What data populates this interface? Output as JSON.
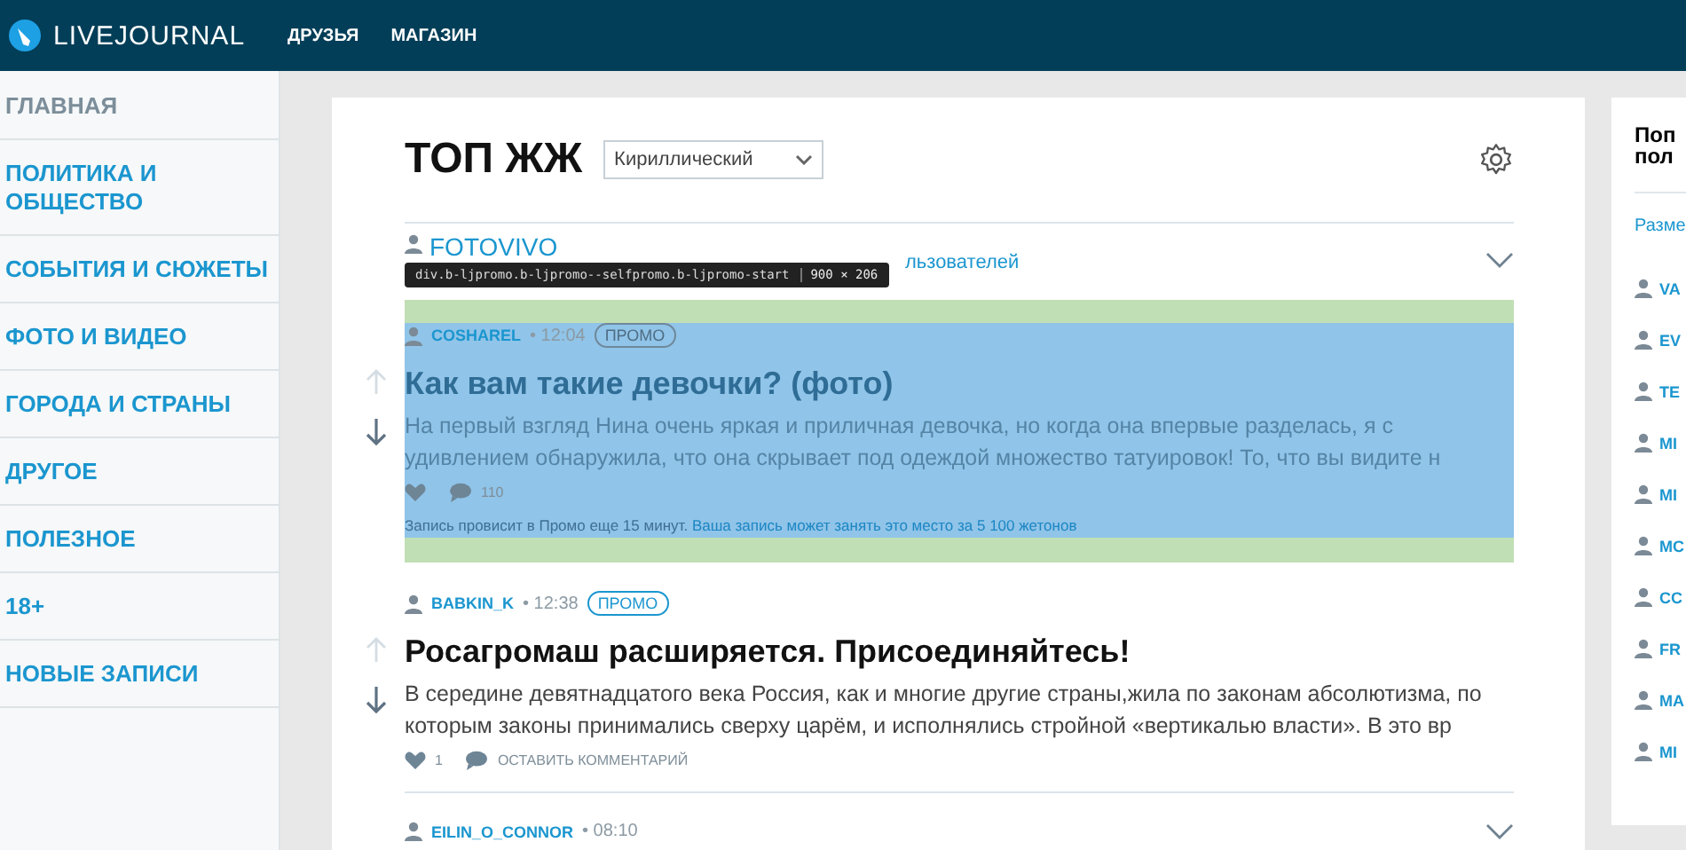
{
  "header": {
    "logo": "LIVEJOURNAL",
    "nav": [
      "ДРУЗЬЯ",
      "МАГАЗИН"
    ]
  },
  "sidebar": {
    "items": [
      "ГЛАВНАЯ",
      "ПОЛИТИКА И ОБЩЕСТВО",
      "СОБЫТИЯ И СЮЖЕТЫ",
      "ФОТО И ВИДЕО",
      "ГОРОДА И СТРАНЫ",
      "ДРУГОЕ",
      "ПОЛЕЗНОЕ",
      "18+",
      "НОВЫЕ ЗАПИСИ"
    ]
  },
  "main": {
    "title": "ТОП ЖЖ",
    "select": {
      "value": "Кириллический"
    },
    "group_row": {
      "author": "FOTOVIVO",
      "text": "льзователей",
      "expanded": false
    },
    "devtools_tooltip": {
      "selector": "div.b-ljpromo.b-ljpromo--selfpromo.b-ljpromo-start",
      "size": "900 × 206"
    },
    "posts": [
      {
        "kind": "promo",
        "highlighted": true,
        "author": "COSHAREL",
        "time": "• 12:04",
        "badge": "ПРОМО",
        "title": "Как вам такие девочки? (фото)",
        "excerpt": "На первый взгляд Нина очень яркая и приличная девочка, но когда она впервые разделась, я с удивлением обнаружила, что она скрывает под одеждой множество татуировок! То, что вы видите н",
        "comments": "110",
        "promo_note": "Запись провисит в Промо еще 15 минут.",
        "promo_link": "Ваша запись может занять это место за 5 100 жетонов"
      },
      {
        "kind": "post",
        "highlighted": false,
        "author": "BABKIN_K",
        "time": "• 12:38",
        "badge": "ПРОМО",
        "title": "Росагромаш расширяется. Присоединяйтесь!",
        "excerpt": "В середине девятнадцатого века Россия, как и многие другие страны,жила по законам абсолютизма, по которым законы принимались сверху царём, и исполнялись стройной «вертикалью власти». В это вр",
        "likes": "1",
        "comments": "ОСТАВИТЬ КОММЕНТАРИЙ"
      },
      {
        "kind": "collapsed",
        "author": "EILIN_O_CONNOR",
        "time": "• 08:10"
      }
    ]
  },
  "right_panel": {
    "title_lines": [
      "Поп",
      "пол"
    ],
    "link": "Разме",
    "users": [
      "VA",
      "EV",
      "TE",
      "MI",
      "MI",
      "MC",
      "CC",
      "FR",
      "MA",
      "MI"
    ]
  }
}
